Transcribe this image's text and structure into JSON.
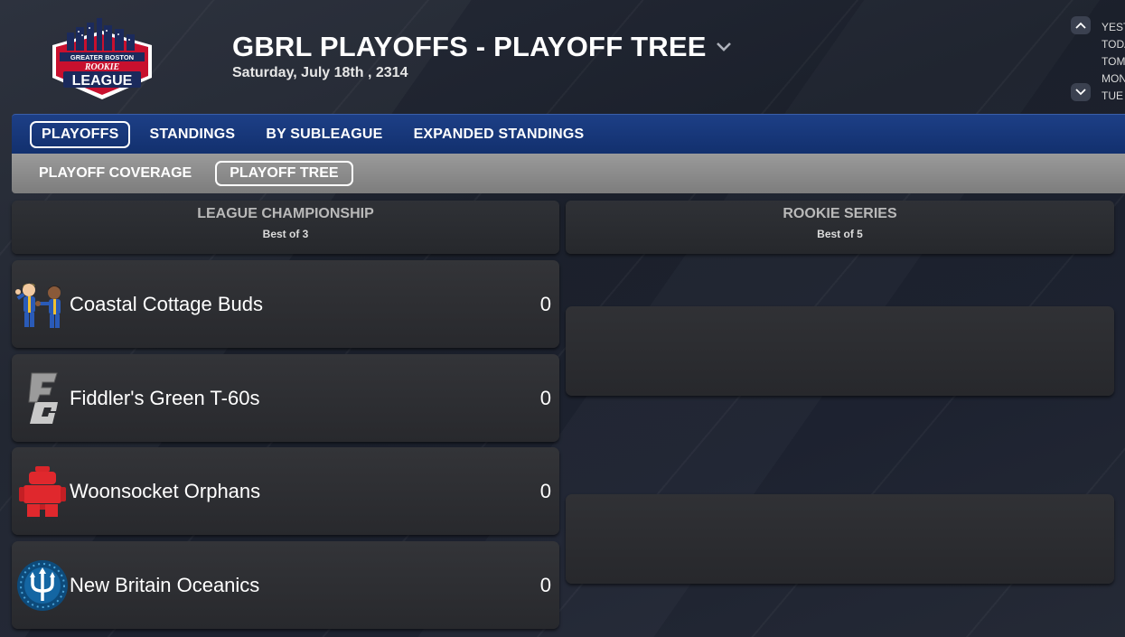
{
  "header": {
    "logo": {
      "line1": "GREATER BOSTON",
      "line2": "ROOKIE",
      "line3": "LEAGUE",
      "primary_color": "#c8102e",
      "secondary_color": "#1b2a5c"
    },
    "title": "GBRL PLAYOFFS - PLAYOFF TREE",
    "date": "Saturday, July 18th , 2314",
    "day_nav": {
      "up_icon": "chevron-up-icon",
      "down_icon": "chevron-down-icon",
      "days": [
        "YEST",
        "TODA",
        "TOM",
        "MON",
        "TUE"
      ]
    }
  },
  "primary_nav": {
    "items": [
      {
        "label": "PLAYOFFS",
        "active": true
      },
      {
        "label": "STANDINGS",
        "active": false
      },
      {
        "label": "BY SUBLEAGUE",
        "active": false
      },
      {
        "label": "EXPANDED STANDINGS",
        "active": false
      }
    ]
  },
  "secondary_nav": {
    "items": [
      {
        "label": "PLAYOFF COVERAGE",
        "active": false
      },
      {
        "label": "PLAYOFF TREE",
        "active": true
      }
    ]
  },
  "rounds": [
    {
      "title": "LEAGUE CHAMPIONSHIP",
      "subtitle": "Best of 3",
      "teams": [
        {
          "name": "Coastal Cottage Buds",
          "score": "0",
          "logo": "vault-boys-icon"
        },
        {
          "name": "Fiddler's Green T-60s",
          "score": "0",
          "logo": "fg-monogram-icon"
        },
        {
          "name": "Woonsocket Orphans",
          "score": "0",
          "logo": "robot-icon"
        },
        {
          "name": "New Britain Oceanics",
          "score": "0",
          "logo": "trident-icon"
        }
      ]
    },
    {
      "title": "ROOKIE SERIES",
      "subtitle": "Best of 5",
      "teams": []
    }
  ],
  "colors": {
    "nav_blue": "#12306e",
    "subnav_gray": "#8a8a8a",
    "card_dark": "#2c2d31"
  }
}
